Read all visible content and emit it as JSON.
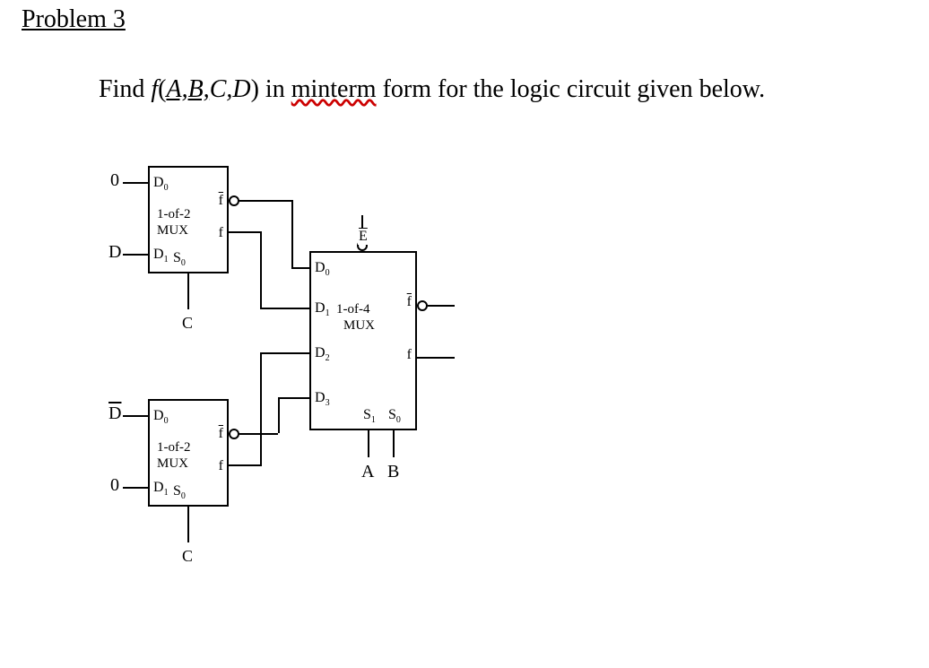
{
  "heading": "Problem 3",
  "prompt": {
    "find": "Find ",
    "func": "f",
    "args_open": "(",
    "args_ab": "A,B,",
    "args_cd": "C,D",
    "args_close": ") in ",
    "minterm": "minterm",
    "rest": " form for the logic circuit given below."
  },
  "mux_small_1": {
    "d0_in": "0",
    "d1_in": "D",
    "d0": "D",
    "d0_sub": "0",
    "d1": "D",
    "d1_sub": "1",
    "s0": "S",
    "s0_sub": "0",
    "type1": "1-of-2",
    "type2": "MUX",
    "fbar": "f",
    "f": "f",
    "sel": "C"
  },
  "mux_small_2": {
    "d0_in": "D",
    "d1_in": "0",
    "d0": "D",
    "d0_sub": "0",
    "d1": "D",
    "d1_sub": "1",
    "s0": "S",
    "s0_sub": "0",
    "type1": "1-of-2",
    "type2": "MUX",
    "fbar": "f",
    "f": "f",
    "sel": "C"
  },
  "mux_big": {
    "d0": "D",
    "d0_sub": "0",
    "d1": "D",
    "d1_sub": "1",
    "d2": "D",
    "d2_sub": "2",
    "d3": "D",
    "d3_sub": "3",
    "s1": "S",
    "s1_sub": "1",
    "s0": "S",
    "s0_sub": "0",
    "type1": "1-of-4",
    "type2": "MUX",
    "fbar": "f",
    "f": "f",
    "enable": "E",
    "sel1": "A",
    "sel0": "B"
  }
}
